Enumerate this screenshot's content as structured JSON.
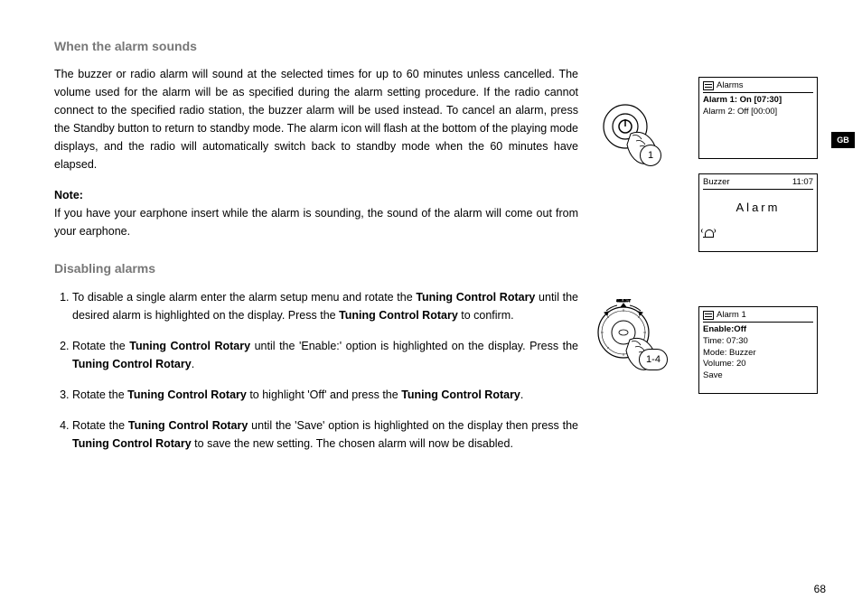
{
  "language_tab": "GB",
  "page_number": "68",
  "section1": {
    "title": "When the alarm sounds",
    "body": "The buzzer or radio alarm will sound at the selected times for up to 60 minutes unless cancelled. The volume used for the alarm will be as specified during the alarm setting procedure. If the radio cannot connect to the specified radio station, the buzzer alarm will be used instead. To cancel an alarm, press the Standby button to return to standby mode. The alarm icon will flash at the bottom of the playing mode displays, and the radio will automatically switch back to standby mode when the 60 minutes have elapsed.",
    "note_label": "Note:",
    "note_text": "If you have your earphone insert while the alarm is sounding, the sound of the alarm will come out from your earphone."
  },
  "section2": {
    "title": "Disabling alarms",
    "steps": {
      "s1a": "To disable a single alarm enter the alarm setup menu and rotate the ",
      "s1b": "Tuning Control Rotary",
      "s1c": " until the desired alarm is highlighted on the display. Press the ",
      "s1d": "Tuning Control Rotary",
      "s1e": " to confirm.",
      "s2a": "Rotate the ",
      "s2b": "Tuning Control Rotary",
      "s2c": " until the 'Enable:' option is highlighted on the display. Press the ",
      "s2d": "Tuning Control Rotary",
      "s2e": ".",
      "s3a": "Rotate the ",
      "s3b": "Tuning Control Rotary",
      "s3c": " to highlight 'Off' and press the ",
      "s3d": "Tuning Control Rotary",
      "s3e": ".",
      "s4a": "Rotate the ",
      "s4b": "Tuning Control Rotary",
      "s4c": " until the 'Save' option is highlighted on the display then press the ",
      "s4d": "Tuning Control Rotary",
      "s4e": " to save the new setting. The chosen alarm will now be disabled."
    }
  },
  "lcd1": {
    "title": "Alarms",
    "row1": "Alarm 1: On [07:30]",
    "row2": "Alarm 2: Off [00:00]"
  },
  "lcd2": {
    "title": "Buzzer",
    "time": "11:07",
    "center": "Alarm"
  },
  "lcd3": {
    "title": "Alarm 1",
    "row1": "Enable:Off",
    "row2": "Time: 07:30",
    "row3": "Mode: Buzzer",
    "row4": "Volume: 20",
    "row5": "Save"
  },
  "badges": {
    "b1": "1",
    "b2": "1-4"
  }
}
